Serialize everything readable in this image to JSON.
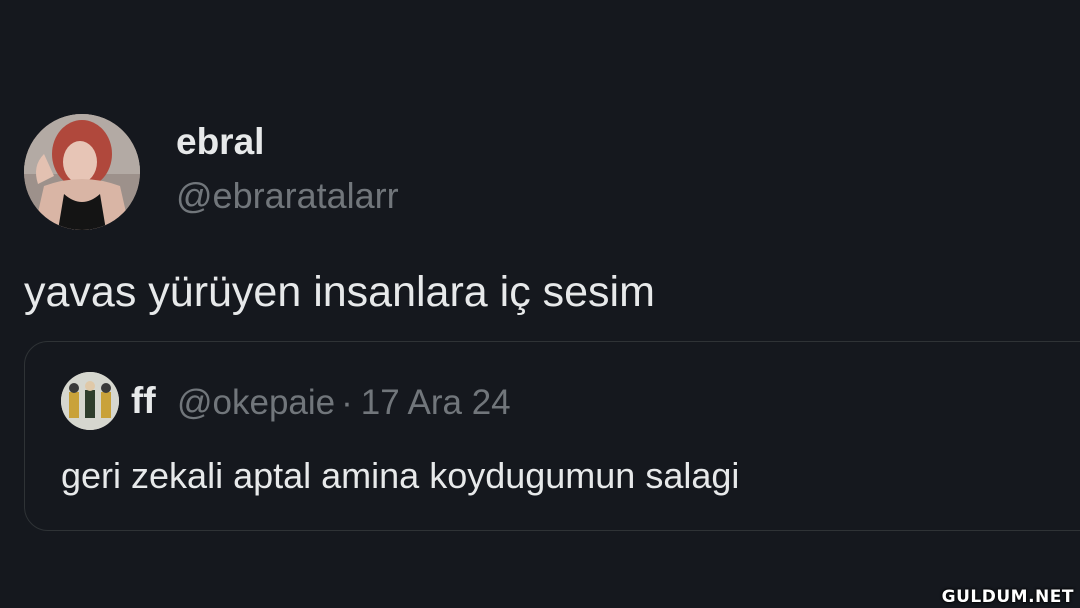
{
  "author": {
    "display_name": "ebral",
    "handle": "@ebraratalarr"
  },
  "tweet": {
    "text": "yavas yürüyen insanlara iç sesim"
  },
  "quoted_tweet": {
    "display_name": "ff",
    "handle": "@okepaie",
    "separator": "·",
    "date": "17 Ara 24",
    "text": "geri zekali aptal amina koydugumun salagi"
  },
  "watermark": "GULDUM.NET",
  "colors": {
    "background": "#15181e",
    "primary_text": "#e7e9ea",
    "secondary_text": "#71767b",
    "border": "#2f3336"
  }
}
